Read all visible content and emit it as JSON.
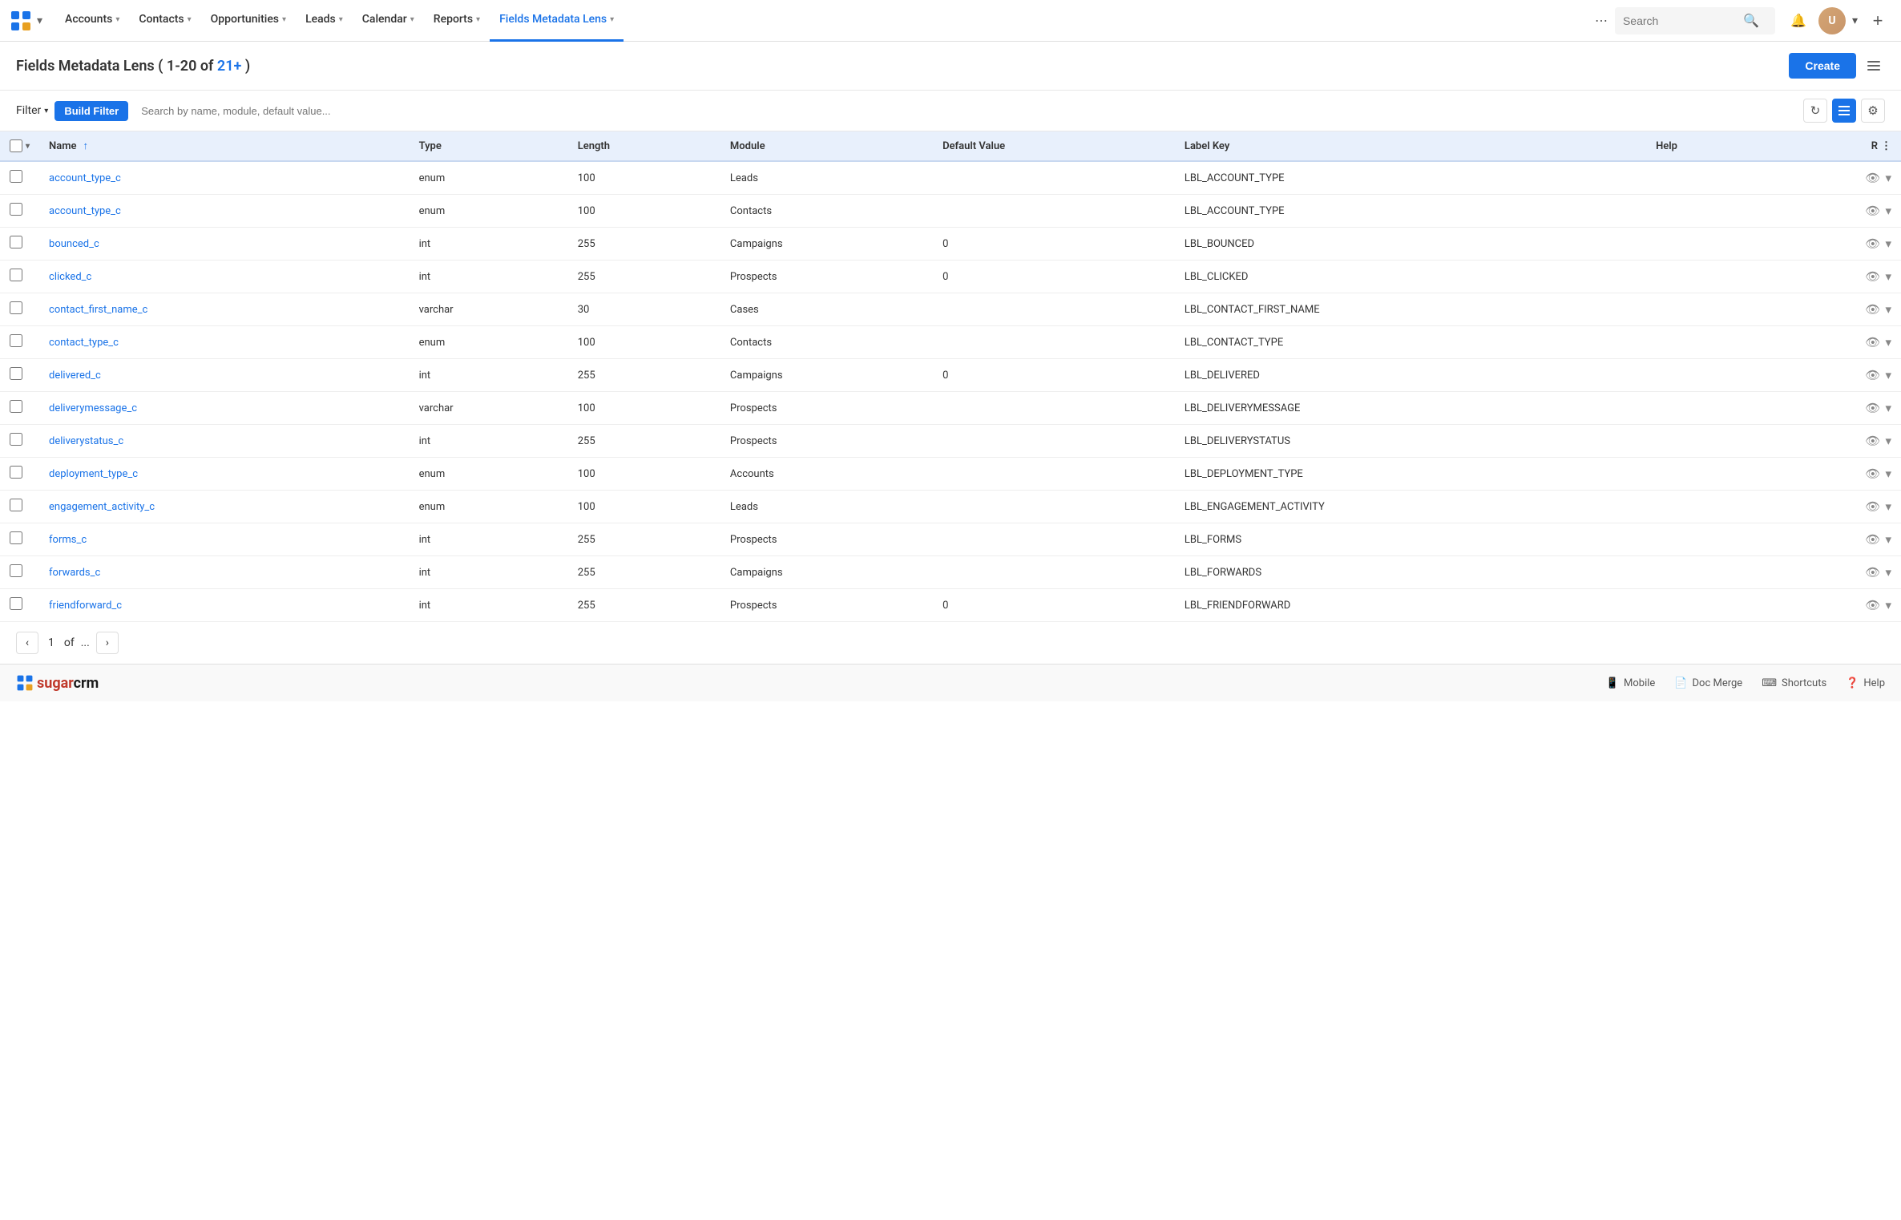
{
  "nav": {
    "items": [
      {
        "id": "accounts",
        "label": "Accounts",
        "active": false
      },
      {
        "id": "contacts",
        "label": "Contacts",
        "active": false
      },
      {
        "id": "opportunities",
        "label": "Opportunities",
        "active": false
      },
      {
        "id": "leads",
        "label": "Leads",
        "active": false
      },
      {
        "id": "calendar",
        "label": "Calendar",
        "active": false
      },
      {
        "id": "reports",
        "label": "Reports",
        "active": false
      },
      {
        "id": "fields-metadata-lens",
        "label": "Fields Metadata Lens",
        "active": true
      }
    ],
    "search_placeholder": "Search",
    "more_icon": "⋯"
  },
  "page": {
    "title": "Fields Metadata Lens",
    "count_prefix": "1-20",
    "count_of": "21+",
    "create_label": "Create"
  },
  "filter": {
    "filter_label": "Filter",
    "build_filter_label": "Build Filter",
    "search_placeholder": "Search by name, module, default value..."
  },
  "table": {
    "columns": [
      {
        "id": "name",
        "label": "Name",
        "sortable": true
      },
      {
        "id": "type",
        "label": "Type",
        "sortable": false
      },
      {
        "id": "length",
        "label": "Length",
        "sortable": false
      },
      {
        "id": "module",
        "label": "Module",
        "sortable": false
      },
      {
        "id": "default_value",
        "label": "Default Value",
        "sortable": false
      },
      {
        "id": "label_key",
        "label": "Label Key",
        "sortable": false
      },
      {
        "id": "help",
        "label": "Help",
        "sortable": false
      },
      {
        "id": "r",
        "label": "R",
        "sortable": false
      }
    ],
    "rows": [
      {
        "name": "account_type_c",
        "type": "enum",
        "length": "100",
        "module": "Leads",
        "default_value": "",
        "label_key": "LBL_ACCOUNT_TYPE"
      },
      {
        "name": "account_type_c",
        "type": "enum",
        "length": "100",
        "module": "Contacts",
        "default_value": "",
        "label_key": "LBL_ACCOUNT_TYPE"
      },
      {
        "name": "bounced_c",
        "type": "int",
        "length": "255",
        "module": "Campaigns",
        "default_value": "0",
        "label_key": "LBL_BOUNCED"
      },
      {
        "name": "clicked_c",
        "type": "int",
        "length": "255",
        "module": "Prospects",
        "default_value": "0",
        "label_key": "LBL_CLICKED"
      },
      {
        "name": "contact_first_name_c",
        "type": "varchar",
        "length": "30",
        "module": "Cases",
        "default_value": "",
        "label_key": "LBL_CONTACT_FIRST_NAME"
      },
      {
        "name": "contact_type_c",
        "type": "enum",
        "length": "100",
        "module": "Contacts",
        "default_value": "",
        "label_key": "LBL_CONTACT_TYPE"
      },
      {
        "name": "delivered_c",
        "type": "int",
        "length": "255",
        "module": "Campaigns",
        "default_value": "0",
        "label_key": "LBL_DELIVERED"
      },
      {
        "name": "deliverymessage_c",
        "type": "varchar",
        "length": "100",
        "module": "Prospects",
        "default_value": "",
        "label_key": "LBL_DELIVERYMESSAGE"
      },
      {
        "name": "deliverystatus_c",
        "type": "int",
        "length": "255",
        "module": "Prospects",
        "default_value": "",
        "label_key": "LBL_DELIVERYSTATUS"
      },
      {
        "name": "deployment_type_c",
        "type": "enum",
        "length": "100",
        "module": "Accounts",
        "default_value": "",
        "label_key": "LBL_DEPLOYMENT_TYPE"
      },
      {
        "name": "engagement_activity_c",
        "type": "enum",
        "length": "100",
        "module": "Leads",
        "default_value": "",
        "label_key": "LBL_ENGAGEMENT_ACTIVITY"
      },
      {
        "name": "forms_c",
        "type": "int",
        "length": "255",
        "module": "Prospects",
        "default_value": "",
        "label_key": "LBL_FORMS"
      },
      {
        "name": "forwards_c",
        "type": "int",
        "length": "255",
        "module": "Campaigns",
        "default_value": "",
        "label_key": "LBL_FORWARDS"
      },
      {
        "name": "friendforward_c",
        "type": "int",
        "length": "255",
        "module": "Prospects",
        "default_value": "0",
        "label_key": "LBL_FRIENDFORWARD"
      }
    ]
  },
  "pagination": {
    "current_page": "1",
    "of_label": "of",
    "dots": "...",
    "prev_icon": "‹",
    "next_icon": "›"
  },
  "footer": {
    "logo_sugar": "sugar",
    "logo_crm": "crm",
    "mobile_label": "Mobile",
    "doc_merge_label": "Doc Merge",
    "shortcuts_label": "Shortcuts",
    "help_label": "Help"
  }
}
